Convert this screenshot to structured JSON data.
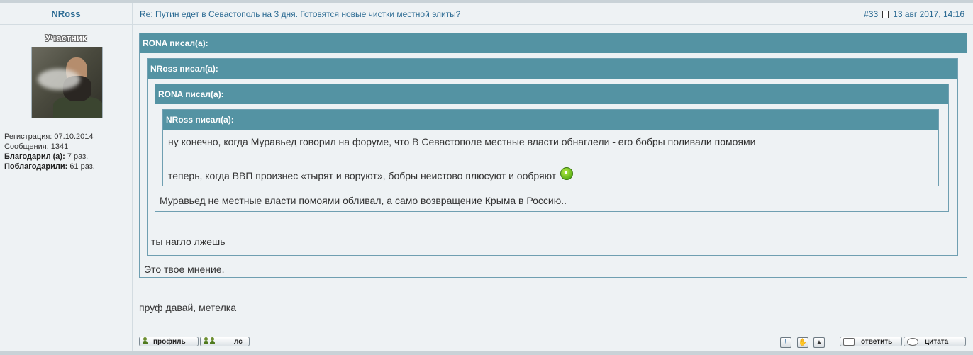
{
  "author": {
    "name": "NRoss",
    "rank": "Участник",
    "registration": "Регистрация: 07.10.2014",
    "messages": "Сообщения: 1341",
    "thanked_label": "Благодарил (а):",
    "thanked_value": "7 раз.",
    "was_thanked_label": "Поблагодарили:",
    "was_thanked_value": "61 раз."
  },
  "post": {
    "title": "Re: Путин едет в Севастополь на 3 дня. Готовятся новые чистки местной элиты?",
    "number": "#33",
    "date": "13 авг 2017, 14:16",
    "text": "пруф давай, метелка"
  },
  "quotes": {
    "q1": {
      "header": "RONA писал(а):",
      "text": "Это твое мнение."
    },
    "q2": {
      "header": "NRoss писал(а):",
      "text": "ты нагло лжешь"
    },
    "q3": {
      "header": "RONA писал(а):",
      "text": "Муравьед не местные власти помоями обливал, а само возвращение Крыма в Россию.."
    },
    "q4": {
      "header": "NRoss писал(а):",
      "text1": "ну конечно, когда Муравьед говорил на форуме, что В Севастополе местные власти обнаглели - его бобры поливали помоями",
      "text2": "теперь, когда ВВП произнес «тырят и воруют», бобры неистово плюсуют и ообряют"
    }
  },
  "footer": {
    "profile": "профиль",
    "pm": "лс",
    "reply": "ответить",
    "quote": "цитата"
  },
  "colors": {
    "quote_header": "#5493a3",
    "link": "#2c6b93",
    "background": "#eef2f4"
  }
}
